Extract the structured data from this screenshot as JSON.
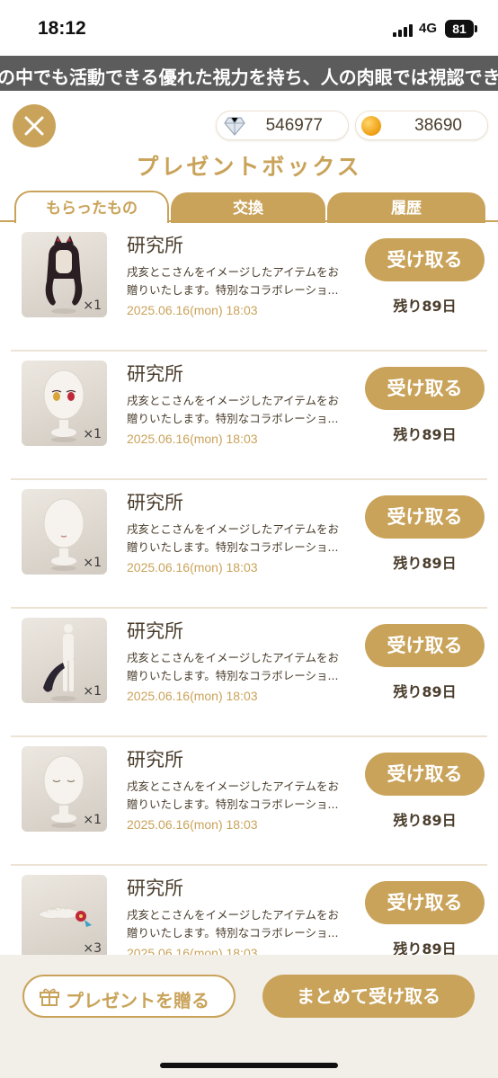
{
  "status_bar": {
    "time": "18:12",
    "network": "4G",
    "battery": "81"
  },
  "ticker": {
    "text": "の中でも活動できる優れた視力を持ち、人の肉眼では視認できない星の"
  },
  "header": {
    "gems": "546977",
    "coins": "38690",
    "title": "プレゼントボックス"
  },
  "tabs": [
    {
      "label": "もらったもの",
      "active": true
    },
    {
      "label": "交換",
      "active": false
    },
    {
      "label": "履歴",
      "active": false
    }
  ],
  "items": [
    {
      "title": "研究所",
      "desc": "戌亥とこさんをイメージしたアイテムをお贈りいたします。特別なコラボレーショ...",
      "date": "2025.06.16(mon) 18:03",
      "qty": "×1",
      "button": "受け取る",
      "remaining": "残り89日",
      "icon": "hair-cat-ears-icon"
    },
    {
      "title": "研究所",
      "desc": "戌亥とこさんをイメージしたアイテムをお贈りいたします。特別なコラボレーショ...",
      "date": "2025.06.16(mon) 18:03",
      "qty": "×1",
      "button": "受け取る",
      "remaining": "残り89日",
      "icon": "eyes-icon"
    },
    {
      "title": "研究所",
      "desc": "戌亥とこさんをイメージしたアイテムをお贈りいたします。特別なコラボレーショ...",
      "date": "2025.06.16(mon) 18:03",
      "qty": "×1",
      "button": "受け取る",
      "remaining": "残り89日",
      "icon": "mouth-icon"
    },
    {
      "title": "研究所",
      "desc": "戌亥とこさんをイメージしたアイテムをお贈りいたします。特別なコラボレーショ...",
      "date": "2025.06.16(mon) 18:03",
      "qty": "×1",
      "button": "受け取る",
      "remaining": "残り89日",
      "icon": "tail-icon"
    },
    {
      "title": "研究所",
      "desc": "戌亥とこさんをイメージしたアイテムをお贈りいたします。特別なコラボレーショ...",
      "date": "2025.06.16(mon) 18:03",
      "qty": "×1",
      "button": "受け取る",
      "remaining": "残り89日",
      "icon": "closed-eyes-icon"
    },
    {
      "title": "研究所",
      "desc": "戌亥とこさんをイメージしたアイテムをお贈りいたします。特別なコラボレーショ...",
      "date": "2025.06.16(mon) 18:03",
      "qty": "×3",
      "button": "受け取る",
      "remaining": "残り89日",
      "icon": "hair-ornament-icon"
    }
  ],
  "bottom": {
    "gift_label": "プレゼントを贈る",
    "claim_all_label": "まとめて受け取る"
  },
  "colors": {
    "accent": "#c9a35a",
    "text": "#4a3d2c",
    "ticker_bg": "#5c5c5c",
    "bottom_bg": "#f2eee8"
  }
}
